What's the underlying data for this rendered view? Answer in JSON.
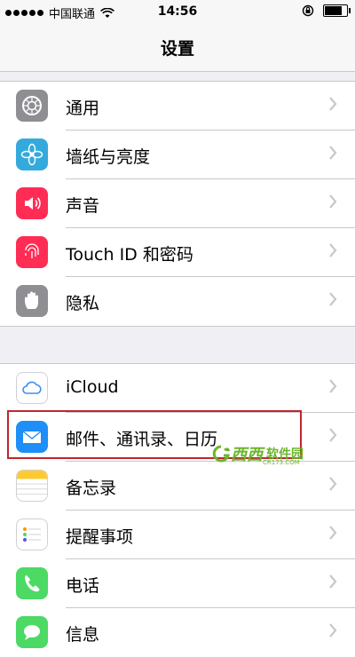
{
  "status_bar": {
    "carrier": "中国联通",
    "time": "14:56",
    "battery_level": 0.85
  },
  "nav": {
    "title": "设置"
  },
  "group1": [
    {
      "label": "通用",
      "icon": "gear-icon",
      "color": "#8e8e93"
    },
    {
      "label": "墙纸与亮度",
      "icon": "flower-icon",
      "color": "#34aadc"
    },
    {
      "label": "声音",
      "icon": "speaker-icon",
      "color": "#ff2d55"
    },
    {
      "label": "Touch ID 和密码",
      "icon": "fingerprint-icon",
      "color": "#ff2d55"
    },
    {
      "label": "隐私",
      "icon": "hand-icon",
      "color": "#8e8e93"
    }
  ],
  "group2": [
    {
      "label": "iCloud",
      "icon": "cloud-icon",
      "color": "#ffffff"
    },
    {
      "label": "邮件、通讯录、日历",
      "icon": "mail-icon",
      "color": "#1e8ef8"
    },
    {
      "label": "备忘录",
      "icon": "notes-icon",
      "color": "#ffffff"
    },
    {
      "label": "提醒事项",
      "icon": "reminders-icon",
      "color": "#ffffff"
    },
    {
      "label": "电话",
      "icon": "phone-icon",
      "color": "#4cd964"
    },
    {
      "label": "信息",
      "icon": "messages-icon",
      "color": "#4cd964"
    }
  ],
  "watermark": {
    "text": "西西",
    "sub": "软件园",
    "url": "CR173.COM"
  }
}
